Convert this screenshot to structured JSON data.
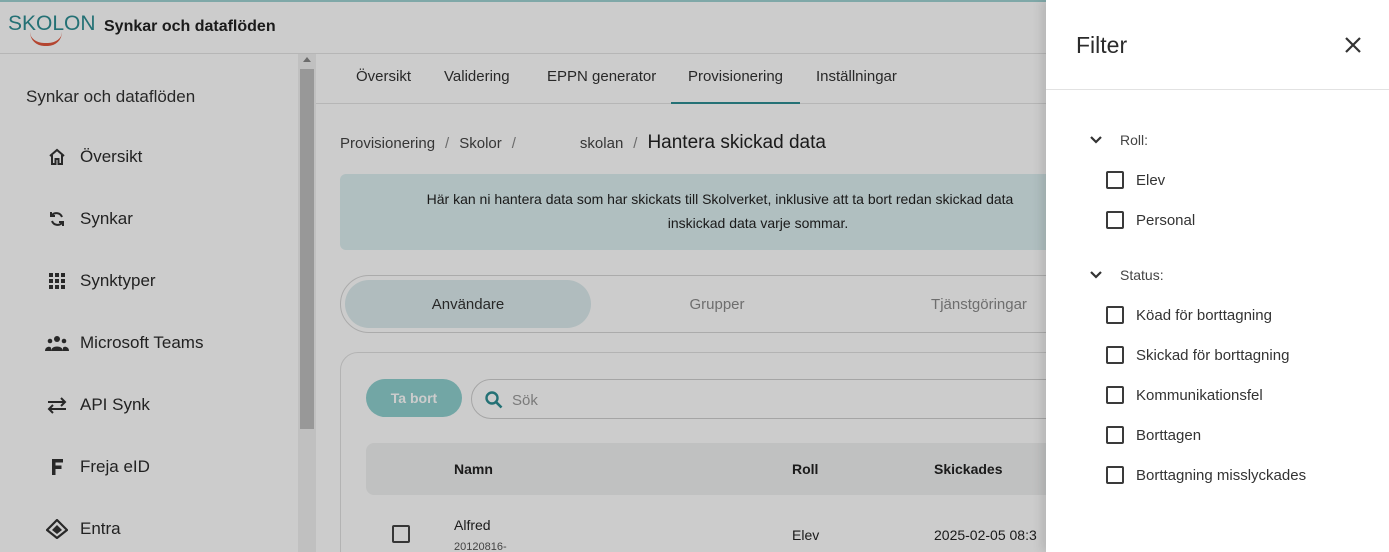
{
  "app": {
    "logo_text": "SKOLON",
    "title": "Synkar och dataflöden"
  },
  "sidebar": {
    "heading": "Synkar och dataflöden",
    "items": [
      {
        "label": "Översikt",
        "icon": "home-icon"
      },
      {
        "label": "Synkar",
        "icon": "sync-icon"
      },
      {
        "label": "Synktyper",
        "icon": "grid-icon"
      },
      {
        "label": "Microsoft Teams",
        "icon": "people-icon"
      },
      {
        "label": "API Synk",
        "icon": "swap-arrows-icon"
      },
      {
        "label": "Freja eID",
        "icon": "freja-f-icon"
      },
      {
        "label": "Entra",
        "icon": "entra-icon"
      }
    ]
  },
  "tabs": [
    {
      "label": "Översikt",
      "active": false
    },
    {
      "label": "Validering",
      "active": false
    },
    {
      "label": "EPPN generator",
      "active": false
    },
    {
      "label": "Provisionering",
      "active": true
    },
    {
      "label": "Inställningar",
      "active": false
    }
  ],
  "breadcrumb": {
    "c1": "Provisionering",
    "c2": "Skolor",
    "c3": "skolan",
    "current": "Hantera skickad data",
    "sep": "/"
  },
  "info": {
    "line1": "Här kan ni hantera data som har skickats till Skolverket, inklusive att ta bort redan skickad data",
    "line2": "inskickad data varje sommar."
  },
  "segments": [
    {
      "label": "Användare",
      "active": true
    },
    {
      "label": "Grupper",
      "active": false
    },
    {
      "label": "Tjänstgöringar",
      "active": false
    }
  ],
  "toolbar": {
    "delete_label": "Ta bort",
    "search_placeholder": "Sök",
    "search_value": ""
  },
  "table": {
    "columns": [
      "Namn",
      "Roll",
      "Skickades"
    ],
    "rows": [
      {
        "name": "Alfred",
        "id": "20120816-",
        "role": "Elev",
        "sent": "2025-02-05 08:3"
      }
    ]
  },
  "filter": {
    "title": "Filter",
    "groups": [
      {
        "label": "Roll:",
        "options": [
          {
            "label": "Elev",
            "checked": false
          },
          {
            "label": "Personal",
            "checked": false
          }
        ]
      },
      {
        "label": "Status:",
        "options": [
          {
            "label": "Köad för borttagning",
            "checked": false
          },
          {
            "label": "Skickad för borttagning",
            "checked": false
          },
          {
            "label": "Kommunikationsfel",
            "checked": false
          },
          {
            "label": "Borttagen",
            "checked": false
          },
          {
            "label": "Borttagning misslyckades",
            "checked": false
          }
        ]
      }
    ]
  },
  "colors": {
    "accent": "#2e8e93",
    "accent_light": "#8fd0cf",
    "info_bg": "#dceff0",
    "logo_smile": "#e2573c"
  }
}
